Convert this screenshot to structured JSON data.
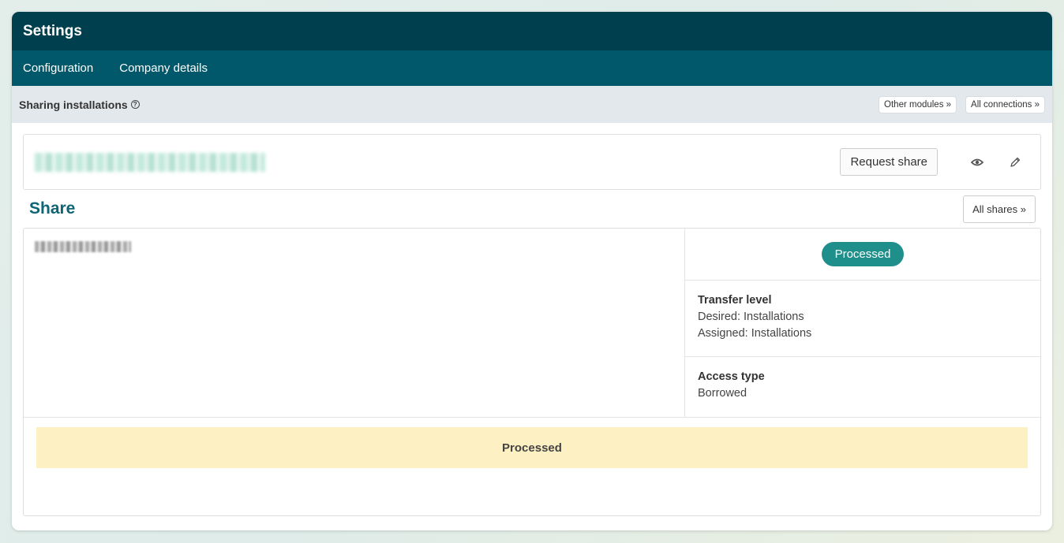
{
  "app": {
    "title": "Settings"
  },
  "nav": {
    "items": [
      {
        "label": "Configuration"
      },
      {
        "label": "Company details"
      }
    ]
  },
  "subheader": {
    "title": "Sharing installations",
    "help_icon": "?",
    "other_modules": "Other modules »",
    "all_connections": "All connections »"
  },
  "installation": {
    "request_share_label": "Request share",
    "view_icon": "eye-icon",
    "edit_icon": "pencil-icon"
  },
  "share": {
    "heading": "Share",
    "all_shares_label": "All shares  »",
    "status": "Processed",
    "transfer_level": {
      "title": "Transfer level",
      "desired": "Desired: Installations",
      "assigned": "Assigned: Installations"
    },
    "access_type": {
      "title": "Access type",
      "value": "Borrowed"
    },
    "banner": "Processed"
  },
  "colors": {
    "title_bar": "#003f4d",
    "nav_bar": "#01586a",
    "status_pill": "#1e8f8a",
    "banner": "#fdf0c2",
    "heading": "#0d6576"
  }
}
